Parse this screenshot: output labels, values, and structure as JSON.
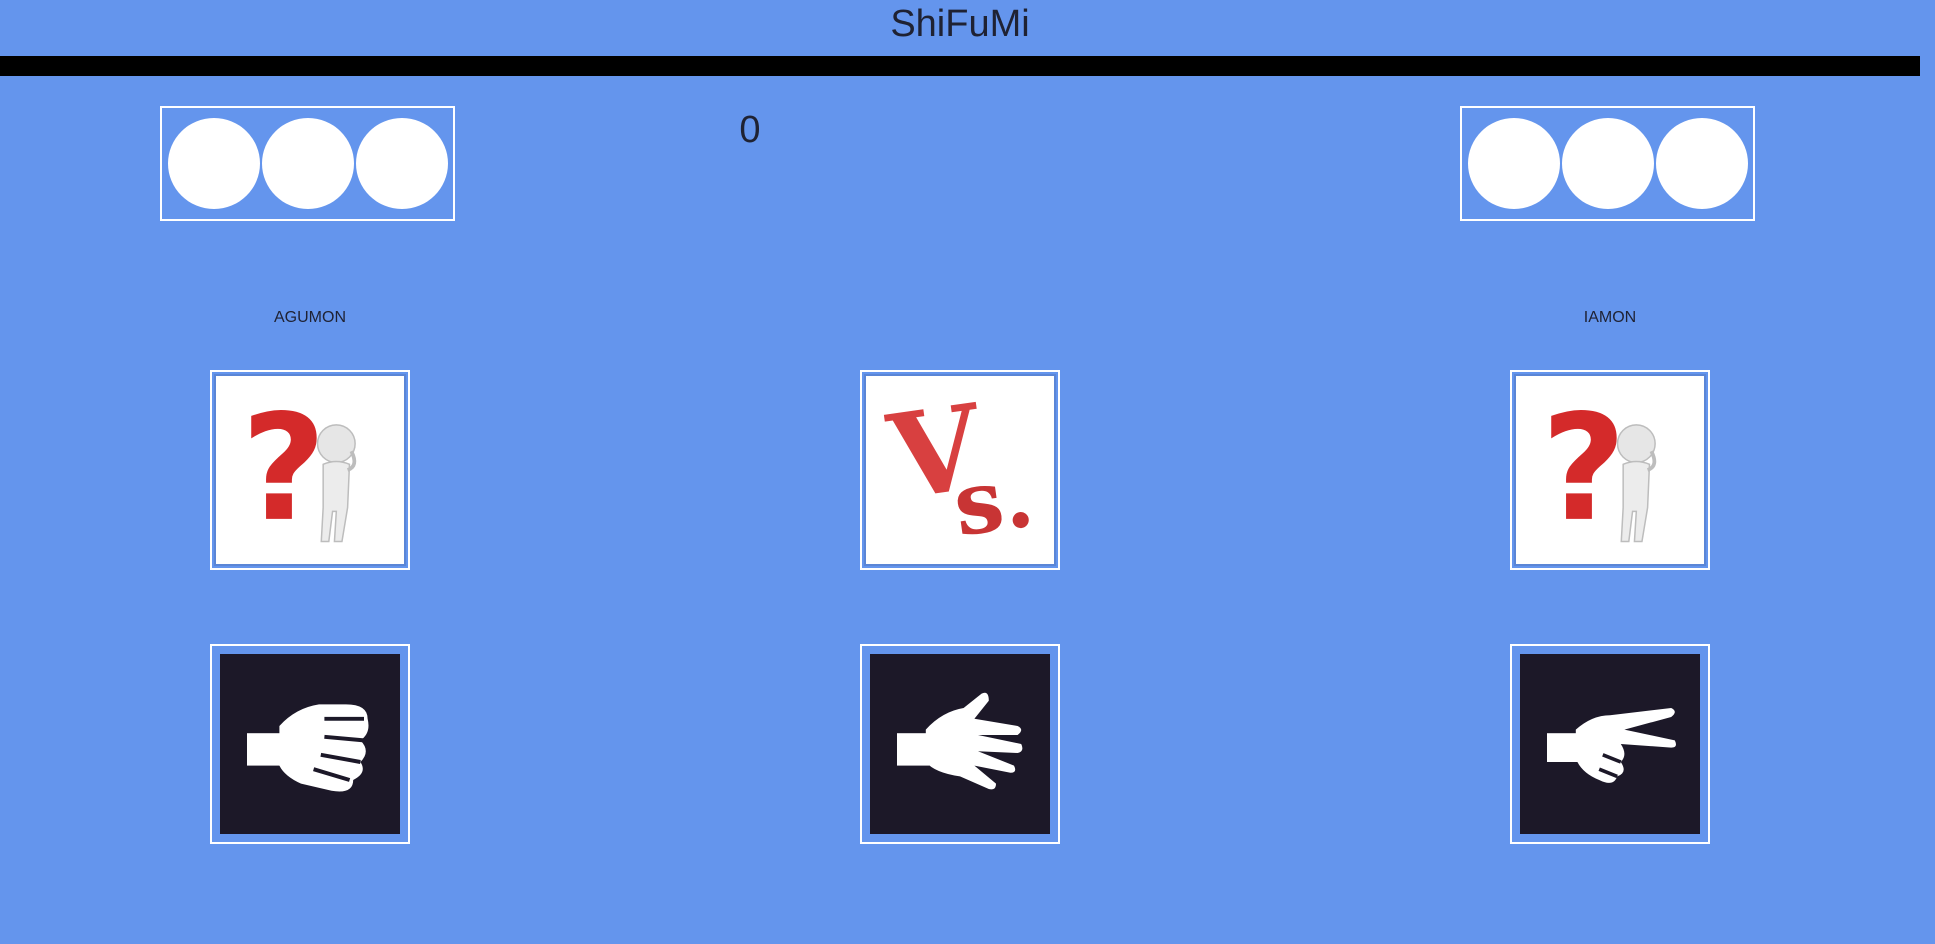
{
  "header": {
    "title": "ShiFuMi"
  },
  "scoreboard": {
    "round_counter": "0",
    "player_left": {
      "name": "AGUMON",
      "lives": 3
    },
    "player_right": {
      "name": "IAMON",
      "lives": 3
    }
  },
  "arena": {
    "left_choice_icon": "question-mark-thinker-icon",
    "versus_icon": "versus-icon",
    "right_choice_icon": "question-mark-thinker-icon"
  },
  "choices": [
    {
      "id": "rock",
      "icon": "fist-rock-icon"
    },
    {
      "id": "paper",
      "icon": "open-hand-paper-icon"
    },
    {
      "id": "scissors",
      "icon": "peace-sign-scissors-icon"
    }
  ],
  "colors": {
    "background": "#6495ED",
    "divider": "#000000",
    "choice_card": "#1c1828",
    "accent_red": "#e03a3a"
  }
}
